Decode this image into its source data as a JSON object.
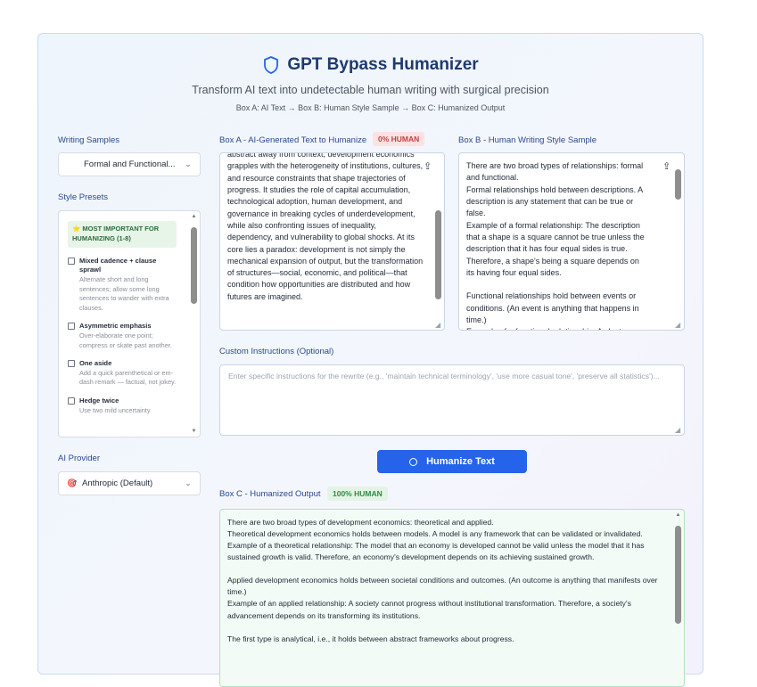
{
  "header": {
    "title": "GPT Bypass Humanizer",
    "subtitle": "Transform AI text into undetectable human writing with surgical precision",
    "flow": "Box A: AI Text → Box B: Human Style Sample → Box C: Humanized Output"
  },
  "sidebar": {
    "writing_samples_label": "Writing Samples",
    "writing_samples_value": "Formal and Functional...",
    "style_presets_label": "Style Presets",
    "presets_banner": "⭐ MOST IMPORTANT FOR HUMANIZING (1-8)",
    "presets": [
      {
        "title": "Mixed cadence + clause sprawl",
        "desc": "Alternate short and long sentences; allow some long sentences to wander with extra clauses."
      },
      {
        "title": "Asymmetric emphasis",
        "desc": "Over-elaborate one point; compress or skate past another."
      },
      {
        "title": "One aside",
        "desc": "Add a quick parenthetical or em-dash remark — factual, not jokey."
      },
      {
        "title": "Hedge twice",
        "desc": "Use two mild uncertainty"
      }
    ],
    "ai_provider_label": "AI Provider",
    "ai_provider_icon": "🎯",
    "ai_provider_value": "Anthropic (Default)"
  },
  "box_a": {
    "label": "Box A - AI-Generated Text to Humanize",
    "badge": "0% HUMAN",
    "text": "abstract away from context, development economics grapples with the heterogeneity of institutions, cultures, and resource constraints that shape trajectories of progress. It studies the role of capital accumulation, technological adoption, human development, and governance in breaking cycles of underdevelopment, while also confronting issues of inequality, dependency, and vulnerability to global shocks. At its core lies a paradox: development is not simply the mechanical expansion of output, but the transformation of structures—social, economic, and political—that condition how opportunities are distributed and how futures are imagined."
  },
  "box_b": {
    "label": "Box B - Human Writing Style Sample",
    "text": "There are two broad types of relationships: formal and functional.\nFormal relationships hold between descriptions. A description is any statement that can be true or false.\nExample of a formal relationship: The description that a shape is a square cannot be true unless the description that it has four equal sides is true. Therefore, a shape's being a square depends on its having four equal sides.\n\nFunctional relationships hold between events or conditions. (An event is anything that happens in time.)\nExample of a functional relationship: A plant"
  },
  "custom": {
    "label": "Custom Instructions (Optional)",
    "placeholder": "Enter specific instructions for the rewrite (e.g., 'maintain technical terminology', 'use more casual tone', 'preserve all statistics')..."
  },
  "humanize_button": "Humanize Text",
  "box_c": {
    "label": "Box C - Humanized Output",
    "badge": "100% HUMAN",
    "text": "There are two broad types of development economics: theoretical and applied.\nTheoretical development economics holds between models. A model is any framework that can be validated or invalidated.\nExample of a theoretical relationship: The model that an economy is developed cannot be valid unless the model that it has sustained growth is valid. Therefore, an economy's development depends on its achieving sustained growth.\n\nApplied development economics holds between societal conditions and outcomes. (An outcome is anything that manifests over time.)\nExample of an applied relationship: A society cannot progress without institutional transformation. Therefore, a society's advancement depends on its transforming its institutions.\n\nThe first type is analytical, i.e., it holds between abstract frameworks about progress."
  },
  "colors": {
    "accent": "#2563eb",
    "title": "#1e3a6e",
    "badge_red": "#c24141",
    "badge_green": "#2e8b46"
  }
}
